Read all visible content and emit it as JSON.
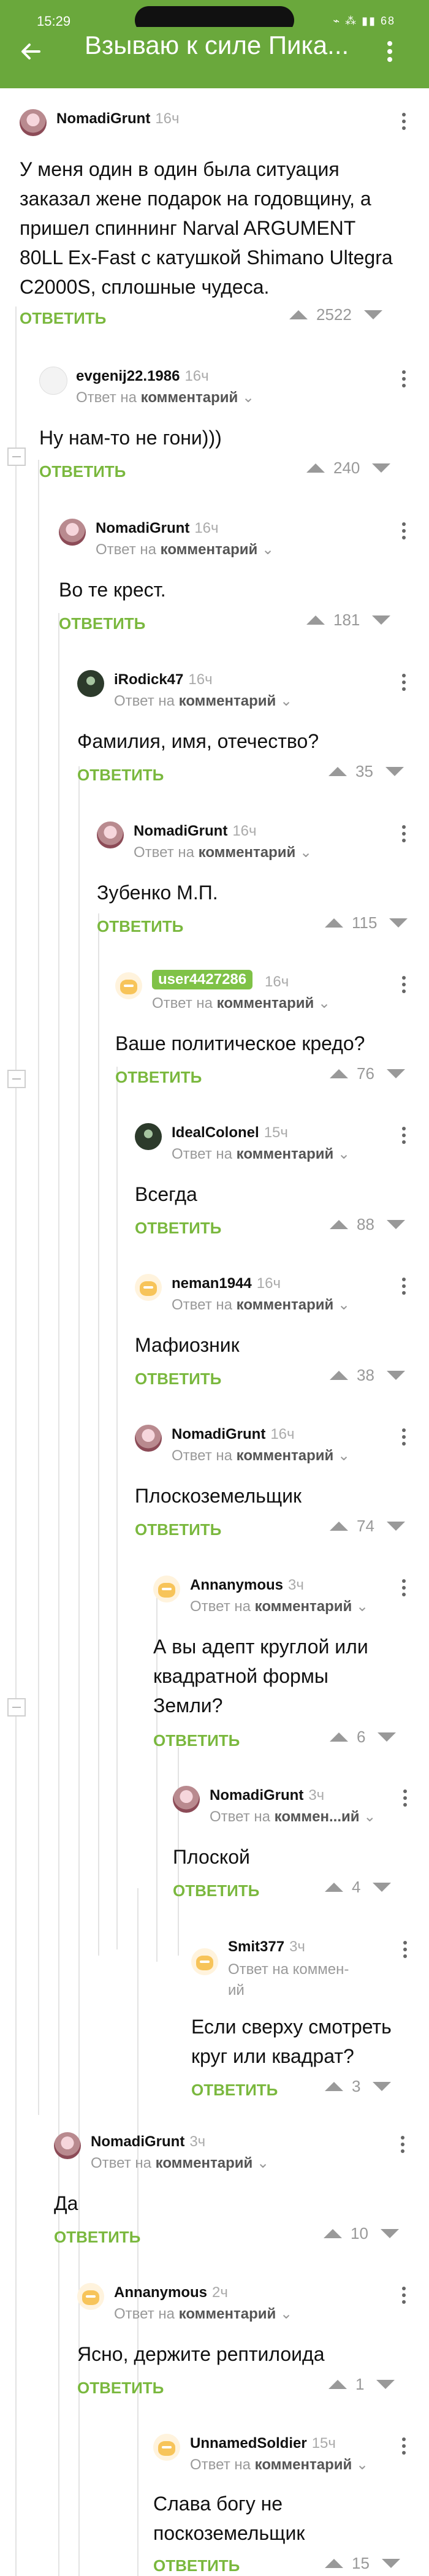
{
  "status_bar": {
    "time": "15:29",
    "icons": "⌁ ⁂ ▮▮ 68"
  },
  "app_bar": {
    "title": "Взываю к силе Пика..."
  },
  "reply_label": "ОТВЕТИТЬ",
  "reply_to_prefix": "Ответ на",
  "reply_to_target": "комментарий",
  "reply_to_target_short": "коммен...ий",
  "comments": [
    {
      "user": "NomadiGrunt",
      "ago": "16ч",
      "text": "У меня один в один была ситуация заказал жене подарок на годовщину, а пришел спиннинг Narval ARGUMENT 80LL Ex-Fast с катушкой Shimano Ultegra C2000S, сплошные чудеса.",
      "votes": "2522"
    },
    {
      "user": "evgenij22.1986",
      "ago": "16ч",
      "text": "Ну нам-то не гони)))",
      "votes": "240"
    },
    {
      "user": "NomadiGrunt",
      "ago": "16ч",
      "text": "Во те крест.",
      "votes": "181"
    },
    {
      "user": "iRodick47",
      "ago": "16ч",
      "text": "Фамилия, имя, отечество?",
      "votes": "35"
    },
    {
      "user": "NomadiGrunt",
      "ago": "16ч",
      "text": "Зубенко М.П.",
      "votes": "115"
    },
    {
      "user": "user4427286",
      "ago": "16ч",
      "text": "Ваше политическое кредо?",
      "votes": "76"
    },
    {
      "user": "IdealColonel",
      "ago": "15ч",
      "text": "Всегда",
      "votes": "88"
    },
    {
      "user": "neman1944",
      "ago": "16ч",
      "text": "Мафиозник",
      "votes": "38"
    },
    {
      "user": "NomadiGrunt",
      "ago": "16ч",
      "text": "Плоскоземельщик",
      "votes": "74"
    },
    {
      "user": "Annanymous",
      "ago": "3ч",
      "text": "А вы адепт круглой или квадратной формы Земли?",
      "votes": "6"
    },
    {
      "user": "NomadiGrunt",
      "ago": "3ч",
      "text": "Плоской",
      "votes": "4"
    },
    {
      "user": "Smit377",
      "ago": "3ч",
      "text": "Если сверху смотреть круг или квадрат?",
      "votes": "3",
      "reply_to_wrap": [
        "Ответ на коммен-",
        "ий"
      ]
    },
    {
      "user": "NomadiGrunt",
      "ago": "3ч",
      "text": "Да",
      "votes": "10"
    },
    {
      "user": "Annanymous",
      "ago": "2ч",
      "text": "Ясно, держите рептилоида",
      "votes": "1"
    },
    {
      "user": "UnnamedSoldier",
      "ago": "15ч",
      "text": "Слава богу не поскоземельщик",
      "votes": "15"
    }
  ]
}
